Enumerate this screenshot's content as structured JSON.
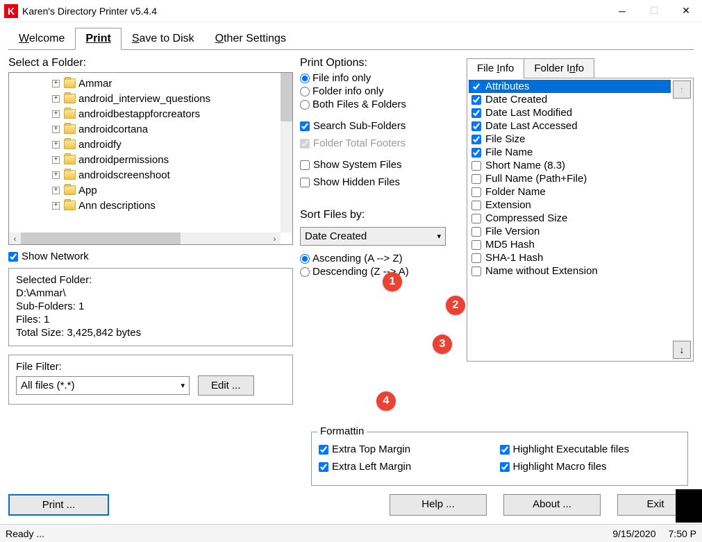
{
  "window": {
    "title": "Karen's Directory Printer v5.4.4"
  },
  "tabs": {
    "welcome": "Welcome",
    "print": "Print",
    "save": "Save to Disk",
    "other": "Other Settings"
  },
  "tree": {
    "label": "Select a Folder:",
    "items": [
      "Ammar",
      "android_interview_questions",
      "androidbestappforcreators",
      "androidcortana",
      "androidfy",
      "androidpermissions",
      "androidscreenshoot",
      "App",
      "Ann  descriptions"
    ]
  },
  "show_network": "Show Network",
  "selected": {
    "label": "Selected Folder:",
    "path": "D:\\Ammar\\",
    "subfolders": "Sub-Folders: 1",
    "files": "Files: 1",
    "totalsize": "Total Size: 3,425,842 bytes"
  },
  "filter": {
    "label": "File Filter:",
    "value": "All files (*.*)",
    "edit": "Edit ..."
  },
  "printopts": {
    "label": "Print Options:",
    "r1": "File info only",
    "r2": "Folder info only",
    "r3": "Both Files & Folders",
    "c1": "Search Sub-Folders",
    "c2": "Folder Total Footers",
    "c3": "Show System Files",
    "c4": "Show Hidden Files"
  },
  "sort": {
    "label": "Sort Files by:",
    "value": "Date Created",
    "asc": "Ascending (A --> Z)",
    "desc": "Descending (Z --> A)"
  },
  "subtabs": {
    "fileinfo": "File Info",
    "folderinfo": "Folder Info"
  },
  "fileinfo": [
    {
      "label": "Attributes",
      "on": true,
      "sel": true
    },
    {
      "label": "Date Created",
      "on": true
    },
    {
      "label": "Date Last Modified",
      "on": true
    },
    {
      "label": "Date Last Accessed",
      "on": true
    },
    {
      "label": "File Size",
      "on": true
    },
    {
      "label": "File Name",
      "on": true
    },
    {
      "label": "Short Name (8.3)",
      "on": false
    },
    {
      "label": "Full Name (Path+File)",
      "on": false
    },
    {
      "label": "Folder Name",
      "on": false
    },
    {
      "label": "Extension",
      "on": false
    },
    {
      "label": "Compressed Size",
      "on": false
    },
    {
      "label": "File Version",
      "on": false
    },
    {
      "label": "MD5 Hash",
      "on": false
    },
    {
      "label": "SHA-1 Hash",
      "on": false
    },
    {
      "label": "Name without Extension",
      "on": false
    }
  ],
  "formatting": {
    "label": "Formattin",
    "c1": "Extra Top Margin",
    "c2": "Extra Left Margin",
    "c3": "Highlight Executable files",
    "c4": "Highlight Macro files"
  },
  "bottom": {
    "print": "Print ...",
    "help": "Help ...",
    "about": "About ...",
    "exit": "Exit"
  },
  "status": {
    "ready": "Ready ...",
    "date": "9/15/2020",
    "time": "7:50 P"
  },
  "ann": {
    "a1": "1",
    "a2": "2",
    "a3": "3",
    "a4": "4"
  }
}
